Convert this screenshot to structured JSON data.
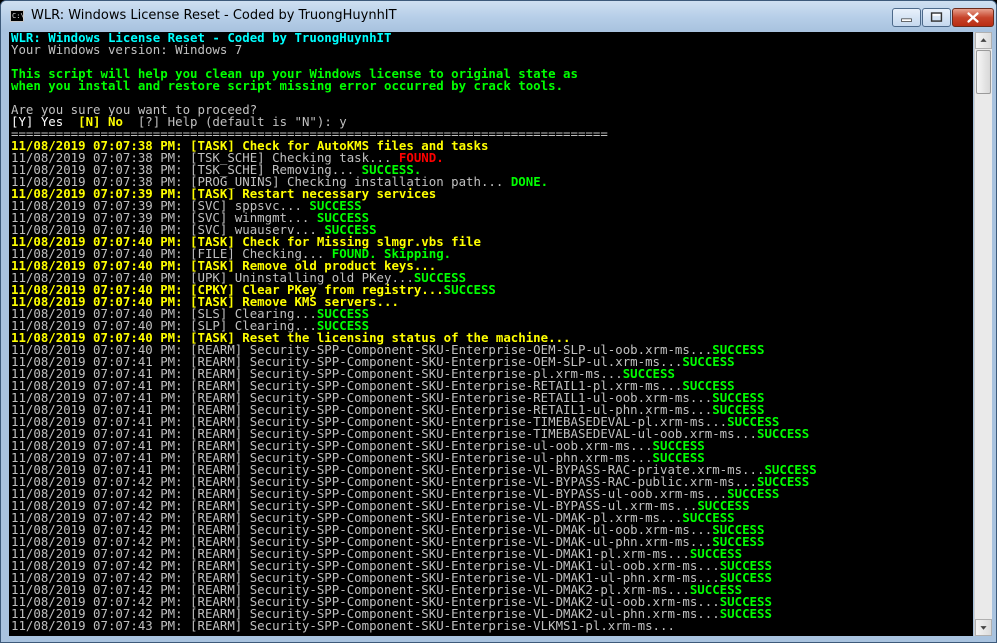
{
  "window": {
    "title": "WLR: Windows License Reset - Coded by TruongHuynhIT",
    "icon": "console-icon",
    "controls": [
      "minimize-icon",
      "maximize-icon",
      "close-icon"
    ]
  },
  "colors": {
    "gray": "#c0c0c0",
    "yellow": "#ffff00",
    "green": "#00ff00",
    "red": "#ff0000",
    "cyan": "#00ffff",
    "white": "#ffffff",
    "background": "#000000"
  },
  "console": {
    "lines": [
      [
        {
          "t": "WLR: Windows License Reset - Coded by TruongHuynhIT",
          "c": "cy"
        }
      ],
      [
        {
          "t": "Your Windows version: Windows 7",
          "c": "g"
        }
      ],
      [
        {
          "t": "",
          "c": "g"
        }
      ],
      [
        {
          "t": "This script will help you clean up your Windows license to original state as",
          "c": "lg"
        }
      ],
      [
        {
          "t": "when you install and restore script missing error occurred by crack tools.",
          "c": "lg"
        }
      ],
      [
        {
          "t": "",
          "c": "g"
        }
      ],
      [
        {
          "t": "Are you sure you want to proceed?",
          "c": "g"
        }
      ],
      [
        {
          "t": "[Y] Yes  ",
          "c": "w"
        },
        {
          "t": "[N] No  ",
          "c": "y"
        },
        {
          "t": "[?] Help (default is \"N\"): y",
          "c": "g"
        }
      ],
      [
        {
          "t": "================================================================================",
          "c": "g"
        }
      ],
      [
        {
          "t": "11/08/2019 07:07:38 PM: [TASK] Check for AutoKMS files and tasks",
          "c": "y"
        }
      ],
      [
        {
          "t": "11/08/2019 07:07:38 PM: [TSK_SCHE] Checking task... ",
          "c": "g"
        },
        {
          "t": "FOUND.",
          "c": "r"
        }
      ],
      [
        {
          "t": "11/08/2019 07:07:38 PM: [TSK_SCHE] Removing... ",
          "c": "g"
        },
        {
          "t": "SUCCESS.",
          "c": "lg"
        }
      ],
      [
        {
          "t": "11/08/2019 07:07:38 PM: [PROG_UNINS] Checking installation path... ",
          "c": "g"
        },
        {
          "t": "DONE.",
          "c": "lg"
        }
      ],
      [
        {
          "t": "11/08/2019 07:07:39 PM: [TASK] Restart necessary services",
          "c": "y"
        }
      ],
      [
        {
          "t": "11/08/2019 07:07:39 PM: [SVC] sppsvc... ",
          "c": "g"
        },
        {
          "t": "SUCCESS",
          "c": "lg"
        }
      ],
      [
        {
          "t": "11/08/2019 07:07:39 PM: [SVC] winmgmt... ",
          "c": "g"
        },
        {
          "t": "SUCCESS",
          "c": "lg"
        }
      ],
      [
        {
          "t": "11/08/2019 07:07:40 PM: [SVC] wuauserv... ",
          "c": "g"
        },
        {
          "t": "SUCCESS",
          "c": "lg"
        }
      ],
      [
        {
          "t": "11/08/2019 07:07:40 PM: [TASK] Check for Missing slmgr.vbs file",
          "c": "y"
        }
      ],
      [
        {
          "t": "11/08/2019 07:07:40 PM: [FILE] Checking... ",
          "c": "g"
        },
        {
          "t": "FOUND. Skipping.",
          "c": "lg"
        }
      ],
      [
        {
          "t": "11/08/2019 07:07:40 PM: [TASK] Remove old product keys...",
          "c": "y"
        }
      ],
      [
        {
          "t": "11/08/2019 07:07:40 PM: [UPK] Uninstalling old PKey...",
          "c": "g"
        },
        {
          "t": "SUCCESS",
          "c": "lg"
        }
      ],
      [
        {
          "t": "11/08/2019 07:07:40 PM: [CPKY] Clear PKey from registry...",
          "c": "y"
        },
        {
          "t": "SUCCESS",
          "c": "lg"
        }
      ],
      [
        {
          "t": "11/08/2019 07:07:40 PM: [TASK] Remove KMS servers...",
          "c": "y"
        }
      ],
      [
        {
          "t": "11/08/2019 07:07:40 PM: [SLS] Clearing...",
          "c": "g"
        },
        {
          "t": "SUCCESS",
          "c": "lg"
        }
      ],
      [
        {
          "t": "11/08/2019 07:07:40 PM: [SLP] Clearing...",
          "c": "g"
        },
        {
          "t": "SUCCESS",
          "c": "lg"
        }
      ],
      [
        {
          "t": "11/08/2019 07:07:40 PM: [TASK] Reset the licensing status of the machine...",
          "c": "y"
        }
      ],
      [
        {
          "t": "11/08/2019 07:07:40 PM: [REARM] Security-SPP-Component-SKU-Enterprise-OEM-SLP-ul-oob.xrm-ms...",
          "c": "g"
        },
        {
          "t": "SUCCESS",
          "c": "lg"
        }
      ],
      [
        {
          "t": "11/08/2019 07:07:41 PM: [REARM] Security-SPP-Component-SKU-Enterprise-OEM-SLP-ul.xrm-ms...",
          "c": "g"
        },
        {
          "t": "SUCCESS",
          "c": "lg"
        }
      ],
      [
        {
          "t": "11/08/2019 07:07:41 PM: [REARM] Security-SPP-Component-SKU-Enterprise-pl.xrm-ms...",
          "c": "g"
        },
        {
          "t": "SUCCESS",
          "c": "lg"
        }
      ],
      [
        {
          "t": "11/08/2019 07:07:41 PM: [REARM] Security-SPP-Component-SKU-Enterprise-RETAIL1-pl.xrm-ms...",
          "c": "g"
        },
        {
          "t": "SUCCESS",
          "c": "lg"
        }
      ],
      [
        {
          "t": "11/08/2019 07:07:41 PM: [REARM] Security-SPP-Component-SKU-Enterprise-RETAIL1-ul-oob.xrm-ms...",
          "c": "g"
        },
        {
          "t": "SUCCESS",
          "c": "lg"
        }
      ],
      [
        {
          "t": "11/08/2019 07:07:41 PM: [REARM] Security-SPP-Component-SKU-Enterprise-RETAIL1-ul-phn.xrm-ms...",
          "c": "g"
        },
        {
          "t": "SUCCESS",
          "c": "lg"
        }
      ],
      [
        {
          "t": "11/08/2019 07:07:41 PM: [REARM] Security-SPP-Component-SKU-Enterprise-TIMEBASEDEVAL-pl.xrm-ms...",
          "c": "g"
        },
        {
          "t": "SUCCESS",
          "c": "lg"
        }
      ],
      [
        {
          "t": "11/08/2019 07:07:41 PM: [REARM] Security-SPP-Component-SKU-Enterprise-TIMEBASEDEVAL-ul-oob.xrm-ms...",
          "c": "g"
        },
        {
          "t": "SUCCESS",
          "c": "lg"
        }
      ],
      [
        {
          "t": "11/08/2019 07:07:41 PM: [REARM] Security-SPP-Component-SKU-Enterprise-ul-oob.xrm-ms...",
          "c": "g"
        },
        {
          "t": "SUCCESS",
          "c": "lg"
        }
      ],
      [
        {
          "t": "11/08/2019 07:07:41 PM: [REARM] Security-SPP-Component-SKU-Enterprise-ul-phn.xrm-ms...",
          "c": "g"
        },
        {
          "t": "SUCCESS",
          "c": "lg"
        }
      ],
      [
        {
          "t": "11/08/2019 07:07:41 PM: [REARM] Security-SPP-Component-SKU-Enterprise-VL-BYPASS-RAC-private.xrm-ms...",
          "c": "g"
        },
        {
          "t": "SUCCESS",
          "c": "lg"
        }
      ],
      [
        {
          "t": "11/08/2019 07:07:42 PM: [REARM] Security-SPP-Component-SKU-Enterprise-VL-BYPASS-RAC-public.xrm-ms...",
          "c": "g"
        },
        {
          "t": "SUCCESS",
          "c": "lg"
        }
      ],
      [
        {
          "t": "11/08/2019 07:07:42 PM: [REARM] Security-SPP-Component-SKU-Enterprise-VL-BYPASS-ul-oob.xrm-ms...",
          "c": "g"
        },
        {
          "t": "SUCCESS",
          "c": "lg"
        }
      ],
      [
        {
          "t": "11/08/2019 07:07:42 PM: [REARM] Security-SPP-Component-SKU-Enterprise-VL-BYPASS-ul.xrm-ms...",
          "c": "g"
        },
        {
          "t": "SUCCESS",
          "c": "lg"
        }
      ],
      [
        {
          "t": "11/08/2019 07:07:42 PM: [REARM] Security-SPP-Component-SKU-Enterprise-VL-DMAK-pl.xrm-ms...",
          "c": "g"
        },
        {
          "t": "SUCCESS",
          "c": "lg"
        }
      ],
      [
        {
          "t": "11/08/2019 07:07:42 PM: [REARM] Security-SPP-Component-SKU-Enterprise-VL-DMAK-ul-oob.xrm-ms...",
          "c": "g"
        },
        {
          "t": "SUCCESS",
          "c": "lg"
        }
      ],
      [
        {
          "t": "11/08/2019 07:07:42 PM: [REARM] Security-SPP-Component-SKU-Enterprise-VL-DMAK-ul-phn.xrm-ms...",
          "c": "g"
        },
        {
          "t": "SUCCESS",
          "c": "lg"
        }
      ],
      [
        {
          "t": "11/08/2019 07:07:42 PM: [REARM] Security-SPP-Component-SKU-Enterprise-VL-DMAK1-pl.xrm-ms...",
          "c": "g"
        },
        {
          "t": "SUCCESS",
          "c": "lg"
        }
      ],
      [
        {
          "t": "11/08/2019 07:07:42 PM: [REARM] Security-SPP-Component-SKU-Enterprise-VL-DMAK1-ul-oob.xrm-ms...",
          "c": "g"
        },
        {
          "t": "SUCCESS",
          "c": "lg"
        }
      ],
      [
        {
          "t": "11/08/2019 07:07:42 PM: [REARM] Security-SPP-Component-SKU-Enterprise-VL-DMAK1-ul-phn.xrm-ms...",
          "c": "g"
        },
        {
          "t": "SUCCESS",
          "c": "lg"
        }
      ],
      [
        {
          "t": "11/08/2019 07:07:42 PM: [REARM] Security-SPP-Component-SKU-Enterprise-VL-DMAK2-pl.xrm-ms...",
          "c": "g"
        },
        {
          "t": "SUCCESS",
          "c": "lg"
        }
      ],
      [
        {
          "t": "11/08/2019 07:07:42 PM: [REARM] Security-SPP-Component-SKU-Enterprise-VL-DMAK2-ul-oob.xrm-ms...",
          "c": "g"
        },
        {
          "t": "SUCCESS",
          "c": "lg"
        }
      ],
      [
        {
          "t": "11/08/2019 07:07:42 PM: [REARM] Security-SPP-Component-SKU-Enterprise-VL-DMAK2-ul-phn.xrm-ms...",
          "c": "g"
        },
        {
          "t": "SUCCESS",
          "c": "lg"
        }
      ],
      [
        {
          "t": "11/08/2019 07:07:43 PM: [REARM] Security-SPP-Component-SKU-Enterprise-VLKMS1-pl.xrm-ms...",
          "c": "g"
        }
      ]
    ]
  }
}
